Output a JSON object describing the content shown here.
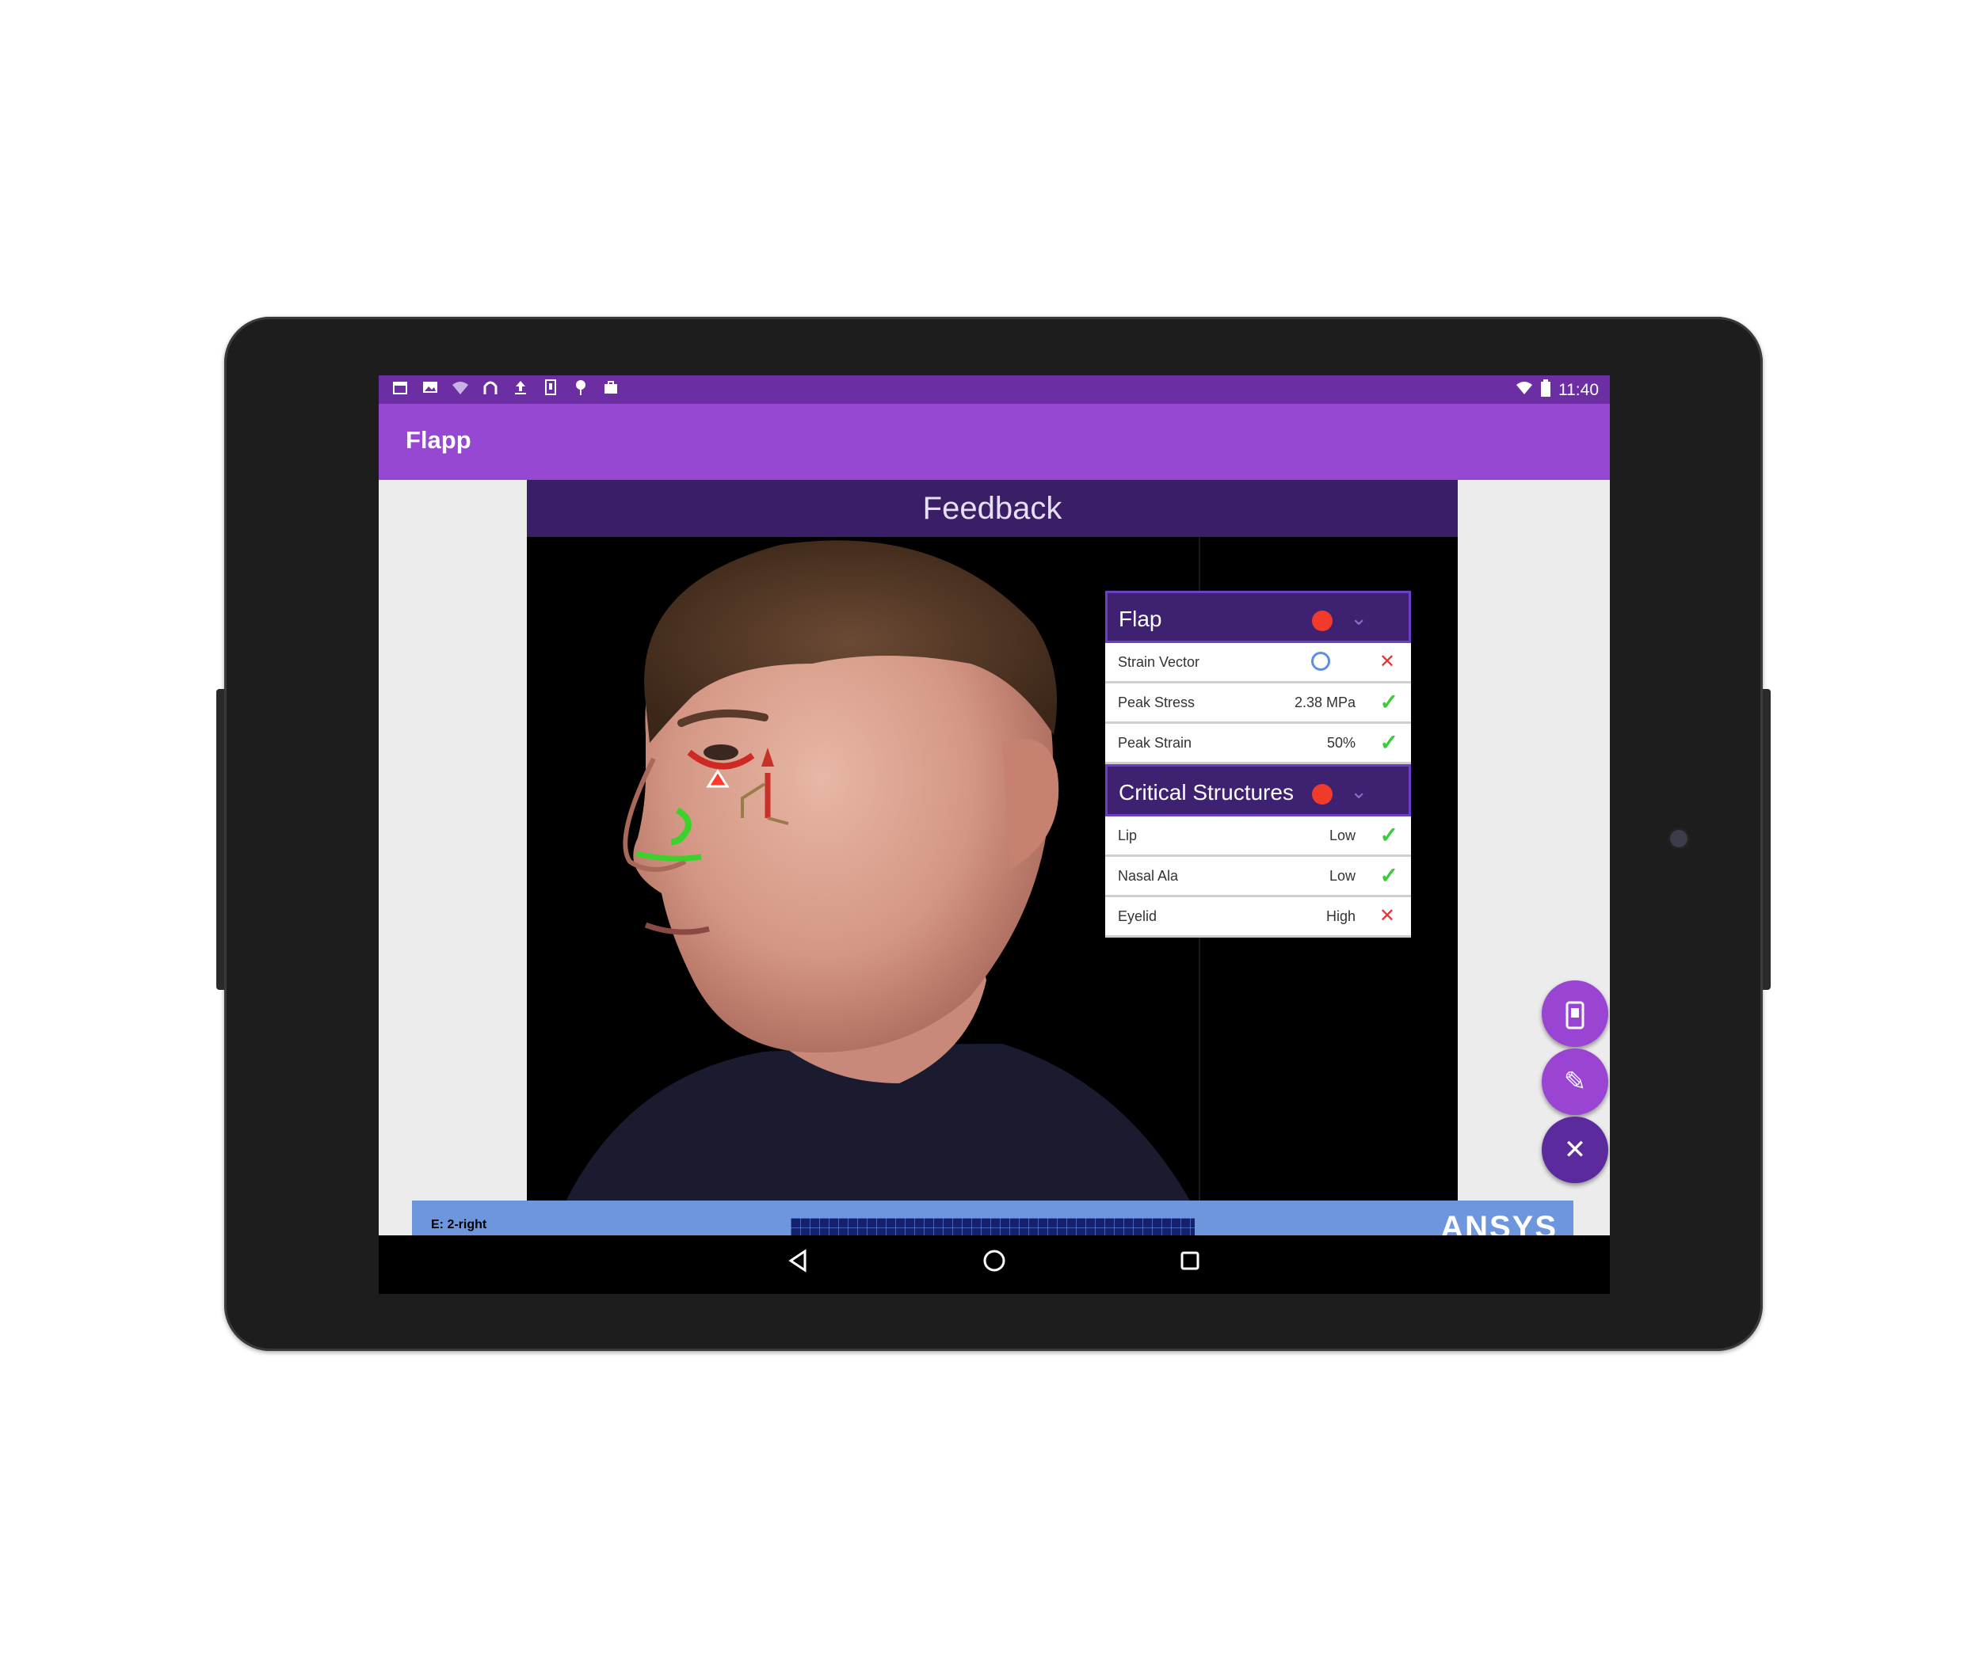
{
  "status_bar": {
    "time": "11:40",
    "left_icons": [
      "calendar-icon",
      "photo-icon",
      "wifi-off-icon",
      "headset-icon",
      "upload-icon",
      "sim-icon",
      "location-icon",
      "briefcase-icon"
    ],
    "right_icons": [
      "wifi-icon",
      "battery-icon"
    ]
  },
  "app": {
    "title": "Flapp"
  },
  "slide": {
    "title": "Feedback",
    "panels": [
      {
        "title": "Flap",
        "status_color": "#f03a2a",
        "rows": [
          {
            "label": "Strain Vector",
            "value": "",
            "status": "fail"
          },
          {
            "label": "Peak Stress",
            "value": "2.38 MPa",
            "status": "pass"
          },
          {
            "label": "Peak Strain",
            "value": "50%",
            "status": "pass"
          }
        ]
      },
      {
        "title": "Critical Structures",
        "status_color": "#f03a2a",
        "rows": [
          {
            "label": "Lip",
            "value": "Low",
            "status": "pass"
          },
          {
            "label": "Nasal Ala",
            "value": "Low",
            "status": "pass"
          },
          {
            "label": "Eyelid",
            "value": "High",
            "status": "fail"
          }
        ]
      }
    ]
  },
  "bottom_strip": {
    "label": "E: 2-right",
    "logo": "ANSYS"
  },
  "glyphs": {
    "check": "✓",
    "cross": "✕",
    "chevron": "⌄",
    "close": "✕",
    "edit": "✎",
    "back": "◁",
    "home": "○",
    "recents": "□"
  },
  "colors": {
    "status_bar": "#6b2fa3",
    "app_bar": "#9648d3",
    "panel_header": "#3f2171",
    "fab": "#9a44d4",
    "fab_dark": "#5b2a9c",
    "pass": "#3ccb3c",
    "fail": "#e8323a"
  }
}
